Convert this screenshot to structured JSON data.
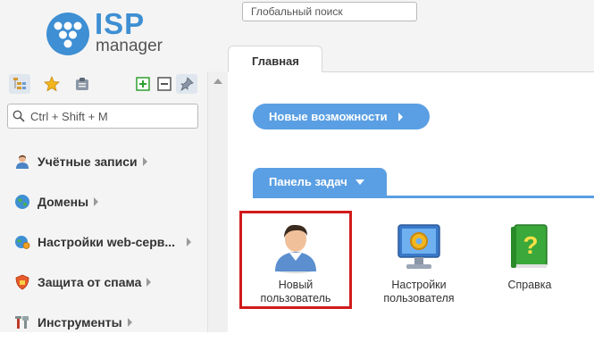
{
  "logo": {
    "brand": "ISP",
    "product": "manager"
  },
  "global_search": {
    "placeholder": "Глобальный поиск"
  },
  "sidebar": {
    "search_placeholder": "Ctrl + Shift + M",
    "toolbar": [
      "tree-view-icon",
      "star-icon",
      "clipboard-icon",
      "expand-all-icon",
      "collapse-all-icon",
      "pin-icon"
    ],
    "items": [
      {
        "label": "Учётные записи",
        "icon": "user-icon"
      },
      {
        "label": "Домены",
        "icon": "globe-icon"
      },
      {
        "label": "Настройки web-серв...",
        "icon": "web-settings-icon"
      },
      {
        "label": "Защита от спама",
        "icon": "shield-icon"
      },
      {
        "label": "Инструменты",
        "icon": "tools-icon"
      }
    ]
  },
  "tabs": [
    {
      "label": "Главная",
      "active": true
    }
  ],
  "news_button": {
    "label": "Новые возможности"
  },
  "task_panel": {
    "label": "Панель задач",
    "tiles": [
      {
        "label_line1": "Новый",
        "label_line2": "пользователь",
        "icon": "new-user-icon",
        "highlighted": true
      },
      {
        "label_line1": "Настройки",
        "label_line2": "пользователя",
        "icon": "user-settings-icon",
        "highlighted": false
      },
      {
        "label_line1": "Справка",
        "label_line2": "",
        "icon": "help-book-icon",
        "highlighted": false
      }
    ]
  },
  "colors": {
    "accent": "#5a9fe3",
    "highlight": "#d11b1b",
    "logo_blue": "#3e8fd3"
  }
}
